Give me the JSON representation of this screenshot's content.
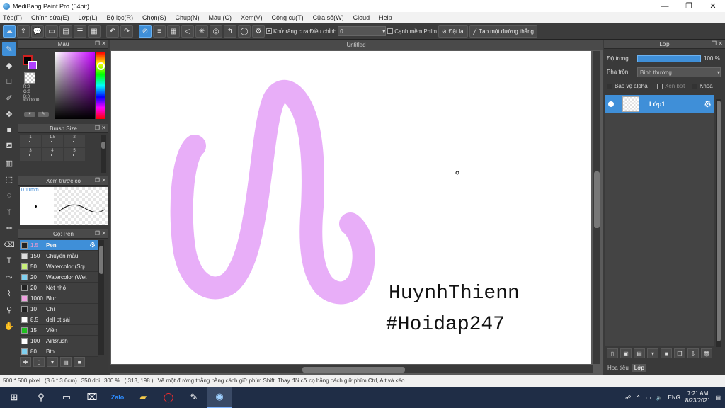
{
  "window": {
    "title": "MediBang Paint Pro (64bit)",
    "minimize": "—",
    "maximize": "❐",
    "close": "✕"
  },
  "menu": [
    "Tệp(F)",
    "Chỉnh sửa(E)",
    "Lớp(L)",
    "Bộ lọc(R)",
    "Chọn(S)",
    "Chụp(N)",
    "Màu (C)",
    "Xem(V)",
    "Công cụ(T)",
    "Cửa số(W)",
    "Cloud",
    "Help"
  ],
  "toolbar": {
    "antialias_label": "Khử răng cưa",
    "adjust_label": "Điều chỉnh",
    "adjust_value": "0",
    "soft_edge_label": "Cạnh mềm",
    "key_label": "Phím",
    "reset_label": "Đặt lại",
    "line_label": "Tạo một đường thẳng"
  },
  "color_panel": {
    "title": "Màu",
    "r": "R:0",
    "g": "G:0",
    "b": "B:0",
    "hex": "#000000"
  },
  "brush_size_panel": {
    "title": "Brush Size",
    "sizes": [
      "1",
      "1.5",
      "2",
      "3",
      "4",
      "5"
    ]
  },
  "preview_panel": {
    "title": "Xem trước cọ",
    "size": "0.11mm"
  },
  "brush_panel": {
    "title": "Cọ: Pen",
    "brushes": [
      {
        "size": "1.5",
        "name": "Pen",
        "color": "#222222",
        "selected": true
      },
      {
        "size": "150",
        "name": "Chuyển mẫu",
        "color": "#dddddd"
      },
      {
        "size": "50",
        "name": "Watercolor (Squ",
        "color": "#c8f07a"
      },
      {
        "size": "20",
        "name": "Watercolor (Wet",
        "color": "#7fd0f0"
      },
      {
        "size": "20",
        "name": "Nét nhỏ",
        "color": "#222222"
      },
      {
        "size": "1000",
        "name": "Blur",
        "color": "#f0a0e0"
      },
      {
        "size": "10",
        "name": "Chì",
        "color": "#222222"
      },
      {
        "size": "8.5",
        "name": "dell bt sài",
        "color": "#ffffff"
      },
      {
        "size": "15",
        "name": "Viền",
        "color": "#20c020"
      },
      {
        "size": "100",
        "name": "AirBrush",
        "color": "#ffffff"
      },
      {
        "size": "80",
        "name": "Bth",
        "color": "#7fd0f0"
      }
    ]
  },
  "canvas": {
    "tab_title": "Untitled",
    "text_line1": "HuynhThienn",
    "text_line2": "#Hoidap247",
    "stroke_color": "#e8aef8"
  },
  "layer_panel": {
    "title": "Lớp",
    "opacity_label": "Độ trong",
    "opacity_value": "100 %",
    "opacity": 1.0,
    "blend_label": "Pha trộn",
    "blend_value": "Bình thường",
    "protect_alpha": "Bảo vệ alpha",
    "clipping": "Xén bớt",
    "lock": "Khóa",
    "layer_name": "Lớp1",
    "tab_navigator": "Hoa tiêu",
    "tab_layer": "Lớp"
  },
  "status": {
    "size": "500 * 500 pixel",
    "dims": "(3.6 * 3.6cm)",
    "dpi": "350 dpi",
    "zoom": "300 %",
    "coords": "( 313, 198 )",
    "hint": "Vẽ một đường thẳng bằng cách giữ phím Shift, Thay đổi cỡ cọ bằng cách giữ phím Ctrl, Alt và kéo"
  },
  "taskbar": {
    "lang": "ENG",
    "time": "7:21 AM",
    "date": "8/23/2021"
  }
}
